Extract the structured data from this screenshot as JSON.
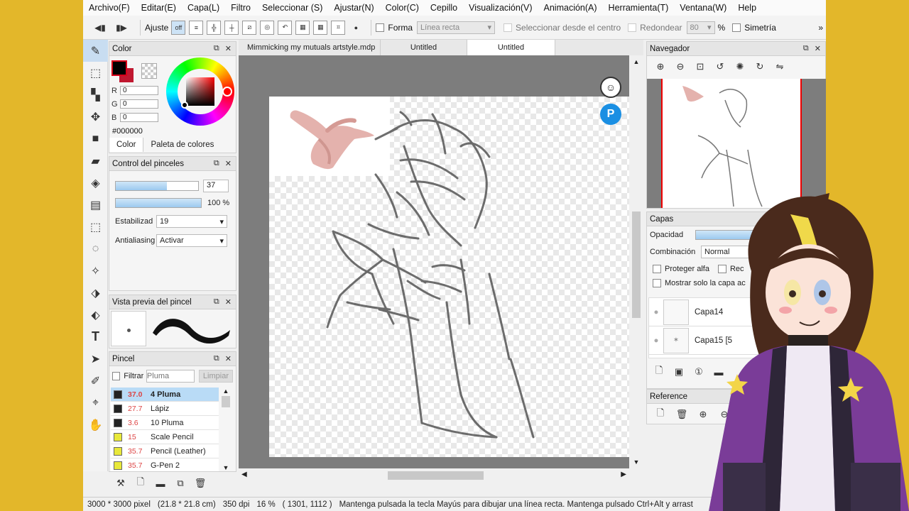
{
  "menu": [
    "Archivo(F)",
    "Editar(E)",
    "Capa(L)",
    "Filtro",
    "Seleccionar (S)",
    "Ajustar(N)",
    "Color(C)",
    "Cepillo",
    "Visualización(V)",
    "Animación(A)",
    "Herramienta(T)",
    "Ventana(W)",
    "Help"
  ],
  "toolbar": {
    "ajuste_label": "Ajuste",
    "ajuste_toggle": "off",
    "forma_label": "Forma",
    "forma_value": "Línea recta",
    "seleccionar_label": "Seleccionar desde el centro",
    "redondear_label": "Redondear",
    "redondear_value": "80",
    "percent": "%",
    "simetria_label": "Simetría"
  },
  "color_panel": {
    "title": "Color",
    "r_label": "R",
    "r_value": "0",
    "g_label": "G",
    "g_value": "0",
    "b_label": "B",
    "b_value": "0",
    "hex": "#000000",
    "tab_color": "Color",
    "tab_palette": "Paleta de colores"
  },
  "brush_control": {
    "title": "Control del pinceles",
    "size_value": "37",
    "size_fill": 0.62,
    "opacity_text": "100 %",
    "opacity_fill": 1.0,
    "stabilizer_label": "Estabilizad",
    "stabilizer_value": "19",
    "antialias_label": "Antialiasing",
    "antialias_value": "Activar"
  },
  "brush_preview": {
    "title": "Vista previa del pincel"
  },
  "brush_panel": {
    "title": "Pincel",
    "filter_label": "Filtrar",
    "filter_placeholder": "Pluma",
    "clear_label": "Limpiar",
    "items": [
      {
        "size": "37.0",
        "name": "4 Pluma",
        "color": "#222222"
      },
      {
        "size": "27.7",
        "name": "Lápiz",
        "color": "#222222"
      },
      {
        "size": "3.6",
        "name": "10 Pluma",
        "color": "#222222"
      },
      {
        "size": "15",
        "name": "Scale Pencil",
        "color": "#e8e83a"
      },
      {
        "size": "35.7",
        "name": "Pencil (Leather)",
        "color": "#e8e83a"
      },
      {
        "size": "35.7",
        "name": "G-Pen 2",
        "color": "#e8e83a"
      }
    ]
  },
  "doc_tabs": [
    "Mimmicking my mutuals artstyle.mdp",
    "Untitled",
    "Untitled"
  ],
  "navigator": {
    "title": "Navegador"
  },
  "layers": {
    "title": "Capas",
    "opacity_label": "Opacidad",
    "blend_label": "Combinación",
    "blend_value": "Normal",
    "protect_alpha": "Proteger alfa",
    "clip_label": "Rec",
    "show_only": "Mostrar solo la capa ac",
    "items": [
      "Capa14",
      "Capa15 [5"
    ]
  },
  "reference": {
    "title": "Reference"
  },
  "status": {
    "size": "3000 * 3000 pixel",
    "cm": "(21.8 * 21.8 cm)",
    "dpi": "350 dpi",
    "zoom": "16 %",
    "coords": "( 1301, 1112 )",
    "hint": "Mantenga pulsada la tecla Mayús para dibujar una línea recta. Mantenga pulsado Ctrl+Alt y arrast"
  }
}
